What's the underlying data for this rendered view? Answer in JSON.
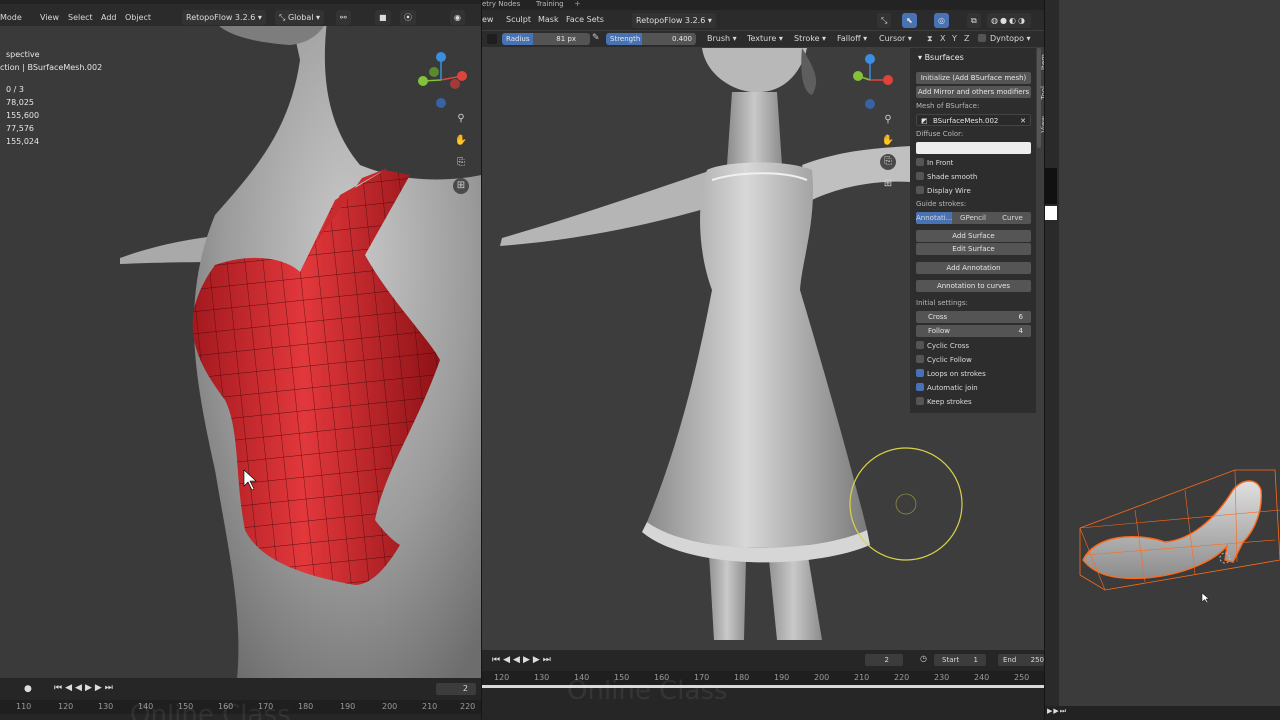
{
  "left": {
    "menus": [
      "Mode",
      "View",
      "Select",
      "Add",
      "Object"
    ],
    "addon_dropdown": "RetopoFlow 3.2.6",
    "orientation": "Global",
    "stats": {
      "view_name": "spective",
      "collection": "ction | BSurfaceMesh.002",
      "objects": "0 / 3",
      "vertices": "78,025",
      "edges": "155,600",
      "faces": "77,576",
      "triangles": "155,024"
    },
    "timeline": {
      "current_frame": "2",
      "ticks": [
        "110",
        "120",
        "130",
        "140",
        "150",
        "160",
        "170",
        "180",
        "190",
        "200",
        "210",
        "220"
      ]
    },
    "watermark": "Online Class"
  },
  "middle": {
    "top_tabs": [
      "etry Nodes",
      "Training"
    ],
    "menus": [
      "ew",
      "Sculpt",
      "Mask",
      "Face Sets"
    ],
    "addon_dropdown": "RetopoFlow 3.2.6",
    "sculpt_header": {
      "radius_label": "Radius",
      "radius_value": "81 px",
      "strength_label": "Strength",
      "strength_value": "0.400",
      "radius_fraction": 0.35,
      "strength_fraction": 0.4,
      "menus": [
        "Brush",
        "Texture",
        "Stroke",
        "Falloff",
        "Cursor"
      ],
      "axes": [
        "X",
        "Y",
        "Z"
      ],
      "dyntopo": "Dyntopo"
    },
    "timeline": {
      "current_frame": "2",
      "start_label": "Start",
      "start_value": "1",
      "end_label": "End",
      "end_value": "250",
      "ticks": [
        "120",
        "130",
        "140",
        "150",
        "160",
        "170",
        "180",
        "190",
        "200",
        "210",
        "220",
        "230",
        "240",
        "250"
      ]
    },
    "watermark": "Online Class"
  },
  "bsurfaces": {
    "title": "Bsurfaces",
    "initialize": "Initialize (Add BSurface mesh)",
    "add_mirror": "Add Mirror and others modifiers",
    "mesh_label": "Mesh of BSurface:",
    "mesh_value": "BSurfaceMesh.002",
    "diffuse_label": "Diffuse Color:",
    "diffuse_color": "#eeeeee",
    "in_front": "In Front",
    "shade_smooth": "Shade smooth",
    "display_wire": "Display Wire",
    "guide_label": "Guide strokes:",
    "guide_options": [
      "Annotati...",
      "GPencil",
      "Curve"
    ],
    "add_surface": "Add Surface",
    "edit_surface": "Edit Surface",
    "add_annotation": "Add Annotation",
    "annotation_to_curves": "Annotation to curves",
    "initial_label": "Initial settings:",
    "cross_label": "Cross",
    "cross_value": "6",
    "follow_label": "Follow",
    "follow_value": "4",
    "cyclic_cross": "Cyclic Cross",
    "cyclic_follow": "Cyclic Follow",
    "loops_on_strokes": "Loops on strokes",
    "automatic_join": "Automatic join",
    "keep_strokes": "Keep strokes"
  },
  "sidebar_tabs": [
    "Item",
    "Tool",
    "View"
  ],
  "colors": {
    "accent": "#4772b3",
    "mesh_red": "#c8262b",
    "shoe_orange": "#ff6a1a",
    "brush_circle": "#d9d24a"
  }
}
